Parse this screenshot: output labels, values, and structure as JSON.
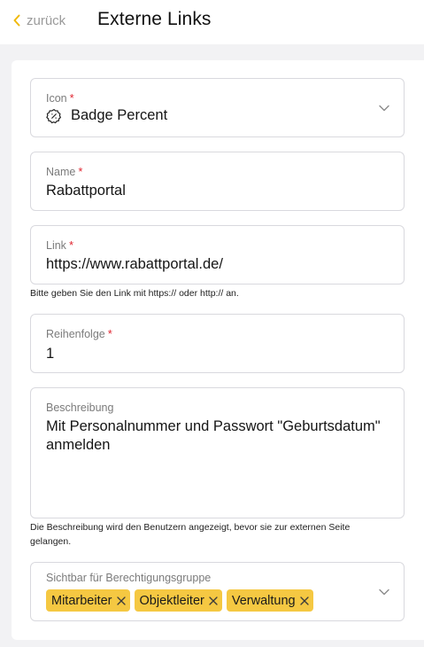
{
  "header": {
    "back_label": "zurück",
    "title": "Externe Links"
  },
  "form": {
    "icon": {
      "label": "Icon",
      "required": "*",
      "value": "Badge Percent",
      "icon_name": "badge-percent-icon"
    },
    "name": {
      "label": "Name",
      "required": "*",
      "value": "Rabattportal"
    },
    "link": {
      "label": "Link",
      "required": "*",
      "value": "https://www.rabattportal.de/",
      "help": "Bitte geben Sie den Link mit https:// oder http:// an."
    },
    "order": {
      "label": "Reihenfolge",
      "required": "*",
      "value": "1"
    },
    "description": {
      "label": "Beschreibung",
      "value": "Mit Personalnummer und Passwort \"Geburtsdatum\" anmelden",
      "help": "Die Beschreibung wird den Benutzern angezeigt, bevor sie zur externen Seite gelangen."
    },
    "visibility": {
      "label": "Sichtbar für Berechtigungsgruppe",
      "tags": [
        {
          "label": "Mitarbeiter"
        },
        {
          "label": "Objektleiter"
        },
        {
          "label": "Verwaltung"
        }
      ]
    }
  },
  "colors": {
    "accent": "#f5c842",
    "required": "#e0242f",
    "background": "#f2f2f4"
  }
}
